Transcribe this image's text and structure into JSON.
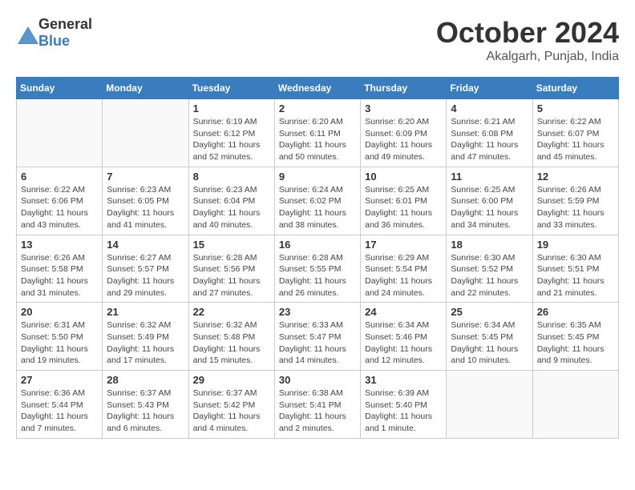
{
  "header": {
    "logo_general": "General",
    "logo_blue": "Blue",
    "month": "October 2024",
    "location": "Akalgarh, Punjab, India"
  },
  "weekdays": [
    "Sunday",
    "Monday",
    "Tuesday",
    "Wednesday",
    "Thursday",
    "Friday",
    "Saturday"
  ],
  "weeks": [
    [
      {
        "day": "",
        "info": ""
      },
      {
        "day": "",
        "info": ""
      },
      {
        "day": "1",
        "info": "Sunrise: 6:19 AM\nSunset: 6:12 PM\nDaylight: 11 hours and 52 minutes."
      },
      {
        "day": "2",
        "info": "Sunrise: 6:20 AM\nSunset: 6:11 PM\nDaylight: 11 hours and 50 minutes."
      },
      {
        "day": "3",
        "info": "Sunrise: 6:20 AM\nSunset: 6:09 PM\nDaylight: 11 hours and 49 minutes."
      },
      {
        "day": "4",
        "info": "Sunrise: 6:21 AM\nSunset: 6:08 PM\nDaylight: 11 hours and 47 minutes."
      },
      {
        "day": "5",
        "info": "Sunrise: 6:22 AM\nSunset: 6:07 PM\nDaylight: 11 hours and 45 minutes."
      }
    ],
    [
      {
        "day": "6",
        "info": "Sunrise: 6:22 AM\nSunset: 6:06 PM\nDaylight: 11 hours and 43 minutes."
      },
      {
        "day": "7",
        "info": "Sunrise: 6:23 AM\nSunset: 6:05 PM\nDaylight: 11 hours and 41 minutes."
      },
      {
        "day": "8",
        "info": "Sunrise: 6:23 AM\nSunset: 6:04 PM\nDaylight: 11 hours and 40 minutes."
      },
      {
        "day": "9",
        "info": "Sunrise: 6:24 AM\nSunset: 6:02 PM\nDaylight: 11 hours and 38 minutes."
      },
      {
        "day": "10",
        "info": "Sunrise: 6:25 AM\nSunset: 6:01 PM\nDaylight: 11 hours and 36 minutes."
      },
      {
        "day": "11",
        "info": "Sunrise: 6:25 AM\nSunset: 6:00 PM\nDaylight: 11 hours and 34 minutes."
      },
      {
        "day": "12",
        "info": "Sunrise: 6:26 AM\nSunset: 5:59 PM\nDaylight: 11 hours and 33 minutes."
      }
    ],
    [
      {
        "day": "13",
        "info": "Sunrise: 6:26 AM\nSunset: 5:58 PM\nDaylight: 11 hours and 31 minutes."
      },
      {
        "day": "14",
        "info": "Sunrise: 6:27 AM\nSunset: 5:57 PM\nDaylight: 11 hours and 29 minutes."
      },
      {
        "day": "15",
        "info": "Sunrise: 6:28 AM\nSunset: 5:56 PM\nDaylight: 11 hours and 27 minutes."
      },
      {
        "day": "16",
        "info": "Sunrise: 6:28 AM\nSunset: 5:55 PM\nDaylight: 11 hours and 26 minutes."
      },
      {
        "day": "17",
        "info": "Sunrise: 6:29 AM\nSunset: 5:54 PM\nDaylight: 11 hours and 24 minutes."
      },
      {
        "day": "18",
        "info": "Sunrise: 6:30 AM\nSunset: 5:52 PM\nDaylight: 11 hours and 22 minutes."
      },
      {
        "day": "19",
        "info": "Sunrise: 6:30 AM\nSunset: 5:51 PM\nDaylight: 11 hours and 21 minutes."
      }
    ],
    [
      {
        "day": "20",
        "info": "Sunrise: 6:31 AM\nSunset: 5:50 PM\nDaylight: 11 hours and 19 minutes."
      },
      {
        "day": "21",
        "info": "Sunrise: 6:32 AM\nSunset: 5:49 PM\nDaylight: 11 hours and 17 minutes."
      },
      {
        "day": "22",
        "info": "Sunrise: 6:32 AM\nSunset: 5:48 PM\nDaylight: 11 hours and 15 minutes."
      },
      {
        "day": "23",
        "info": "Sunrise: 6:33 AM\nSunset: 5:47 PM\nDaylight: 11 hours and 14 minutes."
      },
      {
        "day": "24",
        "info": "Sunrise: 6:34 AM\nSunset: 5:46 PM\nDaylight: 11 hours and 12 minutes."
      },
      {
        "day": "25",
        "info": "Sunrise: 6:34 AM\nSunset: 5:45 PM\nDaylight: 11 hours and 10 minutes."
      },
      {
        "day": "26",
        "info": "Sunrise: 6:35 AM\nSunset: 5:45 PM\nDaylight: 11 hours and 9 minutes."
      }
    ],
    [
      {
        "day": "27",
        "info": "Sunrise: 6:36 AM\nSunset: 5:44 PM\nDaylight: 11 hours and 7 minutes."
      },
      {
        "day": "28",
        "info": "Sunrise: 6:37 AM\nSunset: 5:43 PM\nDaylight: 11 hours and 6 minutes."
      },
      {
        "day": "29",
        "info": "Sunrise: 6:37 AM\nSunset: 5:42 PM\nDaylight: 11 hours and 4 minutes."
      },
      {
        "day": "30",
        "info": "Sunrise: 6:38 AM\nSunset: 5:41 PM\nDaylight: 11 hours and 2 minutes."
      },
      {
        "day": "31",
        "info": "Sunrise: 6:39 AM\nSunset: 5:40 PM\nDaylight: 11 hours and 1 minute."
      },
      {
        "day": "",
        "info": ""
      },
      {
        "day": "",
        "info": ""
      }
    ]
  ]
}
